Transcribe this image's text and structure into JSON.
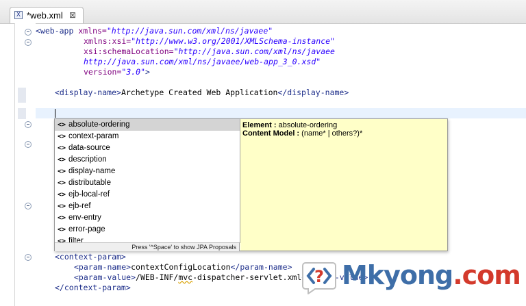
{
  "editor": {
    "tab": {
      "title": "*web.xml",
      "icon": "xml-file-icon",
      "close": "⊠"
    }
  },
  "code_lines": {
    "l1_tag": "<web-app",
    "l1_attr": " xmlns=",
    "l1_val": "\"http://java.sun.com/xml/ns/javaee\"",
    "l2_attr": "xmlns:xsi=",
    "l2_val": "\"http://www.w3.org/2001/XMLSchema-instance\"",
    "l3_attr": "xsi:schemaLocation=",
    "l3_val": "\"http://java.sun.com/xml/ns/javaee",
    "l4_val": "http://java.sun.com/xml/ns/javaee/web-app_3_0.xsd\"",
    "l5_attr": "version=",
    "l5_val": "\"3.0\"",
    "l5_close": ">",
    "dn_open": "<display-name>",
    "dn_text": "Archetype Created Web Application",
    "dn_close": "</display-name>",
    "cp_open": "<context-param>",
    "pn_open": "<param-name>",
    "pn_text": "contextConfigLocation",
    "pn_close": "</param-name>",
    "pv_open": "<param-value>",
    "pv_text_a": "/WEB-INF/",
    "pv_text_b": "mvc",
    "pv_text_c": "-dispatcher-servlet.xml",
    "pv_close": "</param-value>",
    "cp_close": "</context-param>"
  },
  "autocomplete": {
    "items": [
      {
        "icon": "<>",
        "label": "absolute-ordering"
      },
      {
        "icon": "<>",
        "label": "context-param"
      },
      {
        "icon": "<>",
        "label": "data-source"
      },
      {
        "icon": "<>",
        "label": "description"
      },
      {
        "icon": "<>",
        "label": "display-name"
      },
      {
        "icon": "<>",
        "label": "distributable"
      },
      {
        "icon": "<>",
        "label": "ejb-local-ref"
      },
      {
        "icon": "<>",
        "label": "ejb-ref"
      },
      {
        "icon": "<>",
        "label": "env-entry"
      },
      {
        "icon": "<>",
        "label": "error-page"
      },
      {
        "icon": "<>",
        "label": "filter"
      }
    ],
    "status": "Press '^Space' to show JPA Proposals",
    "info": {
      "element_label": "Element :",
      "element_value": "absolute-ordering",
      "content_label": "Content Model :",
      "content_value": "(name* | others?)*"
    }
  },
  "watermark": {
    "brand_a": "Mkyong",
    "brand_b": ".com",
    "icon": "mkyong-logo-icon"
  },
  "colors": {
    "tag": "#1d2e8a",
    "attribute": "#7f007f",
    "value": "#2a00ff",
    "selection": "#d4d4d4",
    "info_bg": "#ffffc8",
    "current_line": "#e8f2fe",
    "brand_blue": "#3e6ea8",
    "brand_red": "#d33a2c"
  }
}
